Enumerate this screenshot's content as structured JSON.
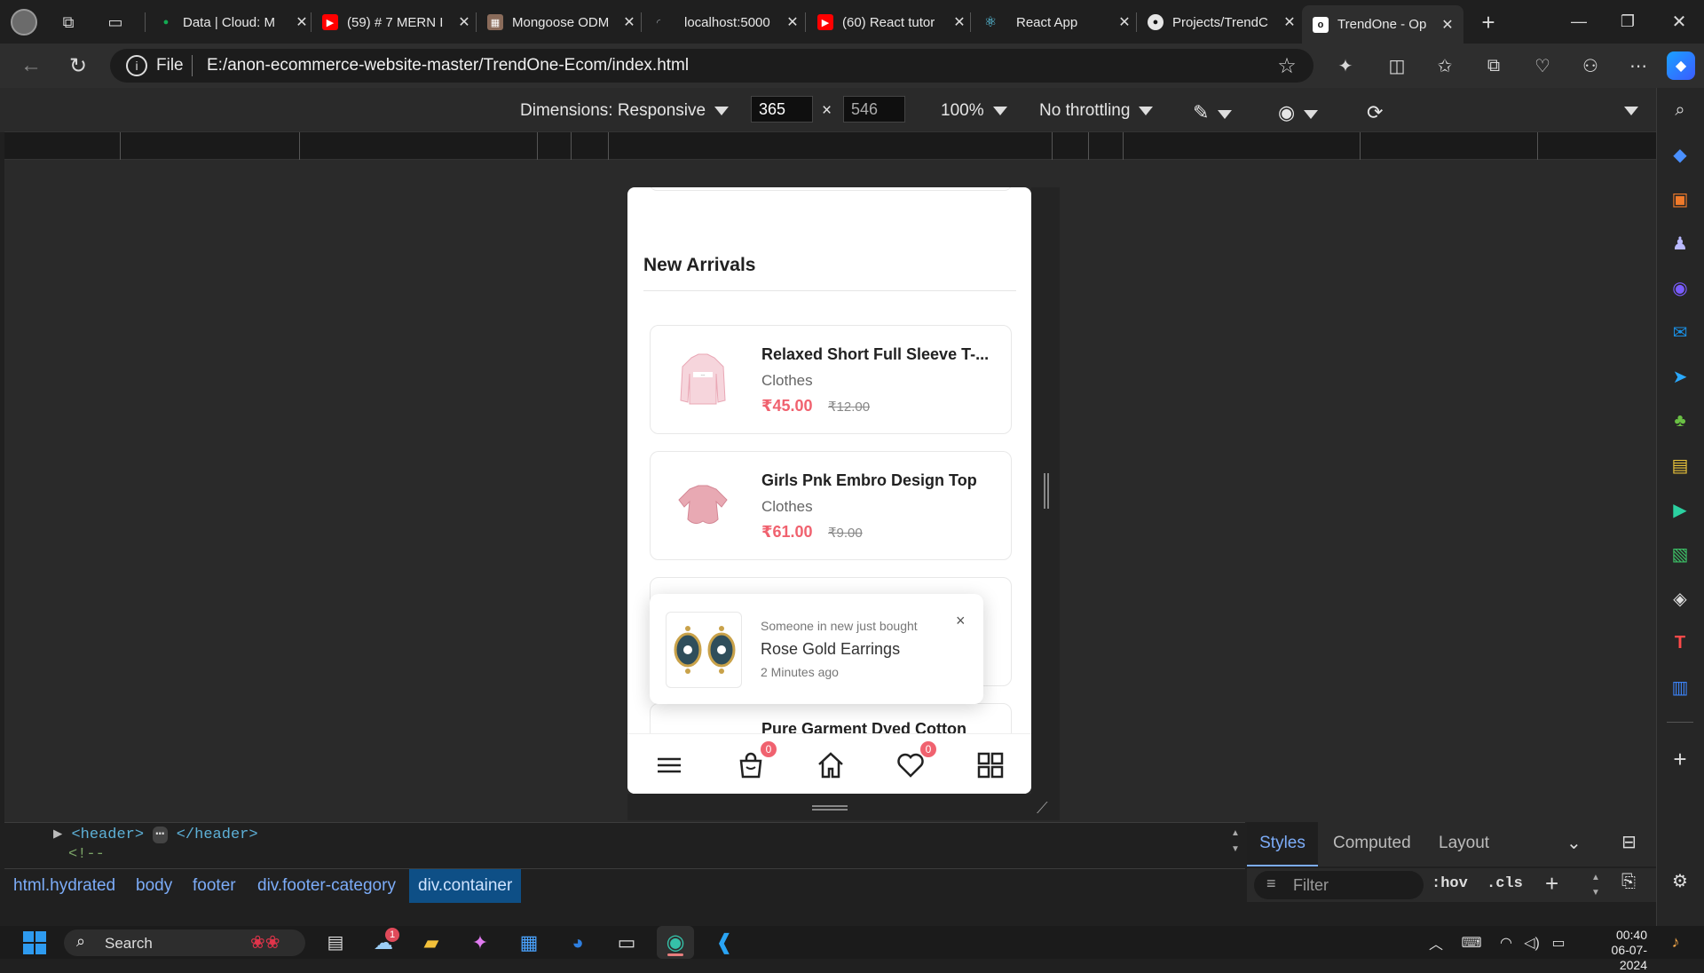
{
  "browser": {
    "tabs": [
      {
        "title": "Data | Cloud: M",
        "color": "#13aa52"
      },
      {
        "title": "(59) # 7 MERN I",
        "color": "#ff0000"
      },
      {
        "title": "Mongoose ODM",
        "color": "#8a6b5a"
      },
      {
        "title": "localhost:5000",
        "color": "#9aa0a6"
      },
      {
        "title": "(60) React tutor",
        "color": "#ff0000"
      },
      {
        "title": "React App",
        "color": "#61dafb"
      },
      {
        "title": "Projects/TrendC",
        "color": "#e6e6e6"
      },
      {
        "title": "TrendOne - Op",
        "color": "#f5c518"
      }
    ],
    "address": {
      "scheme_label": "File",
      "url": "E:/anon-ecommerce-website-master/TrendOne-Ecom/index.html"
    }
  },
  "device_toolbar": {
    "dimensions_label": "Dimensions: Responsive",
    "width": "365",
    "height": "546",
    "times": "×",
    "zoom": "100%",
    "throttling": "No throttling"
  },
  "page": {
    "section_title": "New Arrivals",
    "products": [
      {
        "name": "Relaxed Short Full Sleeve T-...",
        "category": "Clothes",
        "price": "₹45.00",
        "old_price": "₹12.00"
      },
      {
        "name": "Girls Pnk Embro Design Top",
        "category": "Clothes",
        "price": "₹61.00",
        "old_price": "₹9.00"
      },
      {
        "name": "Pure Garment Dyed Cotton",
        "category": "",
        "price": "",
        "old_price": ""
      }
    ],
    "toast": {
      "subtitle": "Someone in new just bought",
      "product": "Rose Gold Earrings",
      "time": "2 Minutes ago",
      "close": "×"
    },
    "bottom_nav": {
      "cart_count": "0",
      "wishlist_count": "0"
    }
  },
  "devtools": {
    "elements_lines": [
      "<header>",
      "</header>",
      "<!--"
    ],
    "breadcrumbs": [
      "html.hydrated",
      "body",
      "footer",
      "div.footer-category",
      "div.container"
    ],
    "style_tabs": [
      "Styles",
      "Computed",
      "Layout"
    ],
    "filter_placeholder": "Filter",
    "hov": ":hov",
    "cls": ".cls"
  },
  "taskbar": {
    "search_placeholder": "Search",
    "time": "00:40",
    "date": "06-07-2024",
    "notif_count": "1"
  }
}
